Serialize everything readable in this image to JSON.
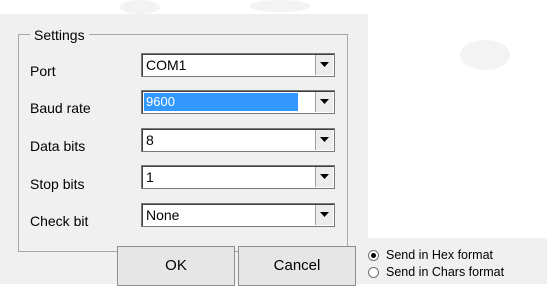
{
  "settings_group": {
    "title": "Settings"
  },
  "fields": [
    {
      "label": "Port",
      "value": "COM1"
    },
    {
      "label": "Baud rate",
      "value": "9600"
    },
    {
      "label": "Data bits",
      "value": "8"
    },
    {
      "label": "Stop bits",
      "value": "1"
    },
    {
      "label": "Check bit",
      "value": "None"
    }
  ],
  "buttons": {
    "ok": "OK",
    "cancel": "Cancel"
  },
  "send_format": {
    "options": [
      {
        "label": "Send in Hex format",
        "selected": true
      },
      {
        "label": "Send in Chars format",
        "selected": false
      }
    ]
  },
  "icons": {
    "dropdown": "chevron-down-icon"
  },
  "colors": {
    "selection": "#3399ff",
    "dialog_bg": "#f0f0f0"
  }
}
